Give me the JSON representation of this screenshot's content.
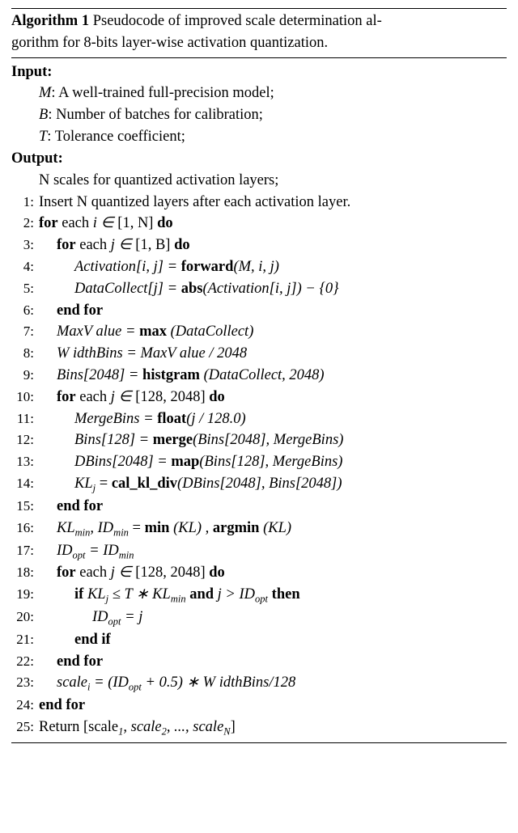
{
  "title": {
    "label": "Algorithm 1",
    "caption_a": "Pseudocode of improved scale determination al-",
    "caption_b": "gorithm for 8-bits layer-wise activation quantization."
  },
  "input_label": "Input:",
  "output_label": "Output:",
  "inputs": {
    "M_sym": "M",
    "M_desc": ": A well-trained full-precision model;",
    "B_sym": "B",
    "B_desc": ": Number of batches for calibration;",
    "T_sym": "T",
    "T_desc": ": Tolerance coefficient;"
  },
  "output_desc": "N scales for quantized activation layers;",
  "kw": {
    "for": "for",
    "each": "each",
    "do": "do",
    "endfor": "end for",
    "if": "if",
    "then": "then",
    "endif": "end if",
    "and": "and"
  },
  "fn": {
    "forward": "forward",
    "abs": "abs",
    "max": "max",
    "histgram": "histgram",
    "float": "float",
    "merge": "merge",
    "map": "map",
    "cal_kl_div": "cal_kl_div",
    "min": "min",
    "argmin": "argmin"
  },
  "lines": {
    "l1": "Insert N quantized layers after each activation layer.",
    "l2_range": " [1, N] ",
    "l3_range": " [1, B] ",
    "l4_lhs": "Activation[i, j] = ",
    "l4_args": "(M, i, j)",
    "l5_lhs": "DataCollect[j] = ",
    "l5_args": "(Activation[i, j]) − {0}",
    "l7_lhs": "MaxV alue = ",
    "l7_args": " (DataCollect)",
    "l8": "W idthBins = MaxV alue / 2048",
    "l9_lhs": "Bins[2048] = ",
    "l9_args": " (DataCollect, 2048)",
    "l10_range": " [128, 2048] ",
    "l11_lhs": "MergeBins = ",
    "l11_args": "(j / 128.0)",
    "l12_lhs": "Bins[128] = ",
    "l12_args": "(Bins[2048], MergeBins)",
    "l13_lhs": "DBins[2048] = ",
    "l13_args": "(Bins[128], MergeBins)",
    "l14_lhs_a": "KL",
    "l14_lhs_b": " = ",
    "l14_args": "(DBins[2048], Bins[2048])",
    "l16_a": "KL",
    "l16_b": ", ID",
    "l16_c": " = ",
    "l16_d": " (KL) , ",
    "l16_e": " (KL)",
    "l17_a": "ID",
    "l17_b": " = ID",
    "l18_range": " [128, 2048] ",
    "l19_a": " KL",
    "l19_b": " ≤ T ∗ KL",
    "l19_c": " j > ID",
    "l20_a": "ID",
    "l20_b": " = j",
    "l23_a": "scale",
    "l23_b": " = (ID",
    "l23_c": " + 0.5) ∗ W idthBins/128",
    "l25_a": "Return [scale",
    "l25_b": ", scale",
    "l25_c": ", ..., scale",
    "l25_d": "]"
  },
  "sub": {
    "j": "j",
    "min": "min",
    "opt": "opt",
    "i": "i",
    "1": "1",
    "2": "2",
    "N": "N"
  },
  "sym": {
    "i_in": "i ∈",
    "j_in": "j ∈"
  },
  "nums": {
    "n1": "1:",
    "n2": "2:",
    "n3": "3:",
    "n4": "4:",
    "n5": "5:",
    "n6": "6:",
    "n7": "7:",
    "n8": "8:",
    "n9": "9:",
    "n10": "10:",
    "n11": "11:",
    "n12": "12:",
    "n13": "13:",
    "n14": "14:",
    "n15": "15:",
    "n16": "16:",
    "n17": "17:",
    "n18": "18:",
    "n19": "19:",
    "n20": "20:",
    "n21": "21:",
    "n22": "22:",
    "n23": "23:",
    "n24": "24:",
    "n25": "25:"
  }
}
